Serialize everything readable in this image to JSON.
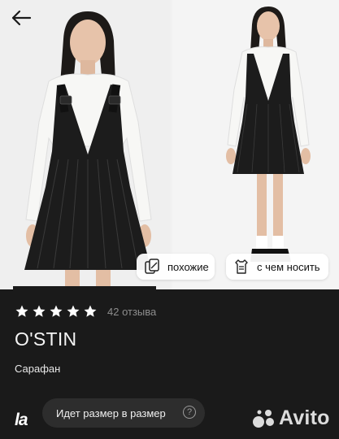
{
  "nav": {
    "back_icon": "arrow-left-icon"
  },
  "gallery": {
    "progress_fraction": 0.5,
    "chips": [
      {
        "label": "похожие",
        "icon": "similar-icon"
      },
      {
        "label": "с чем носить",
        "icon": "outfit-icon"
      }
    ]
  },
  "product": {
    "rating_stars": 5,
    "reviews": "42 отзыва",
    "brand": "O'STIN",
    "category": "Сарафан"
  },
  "size": {
    "logo": "la",
    "label": "Идет размер в размер",
    "help": "?"
  },
  "watermark": {
    "text": "Avito"
  },
  "colors": {
    "background": "#1a1a1a",
    "star": "#ffffff",
    "muted": "#8d8d8d"
  }
}
